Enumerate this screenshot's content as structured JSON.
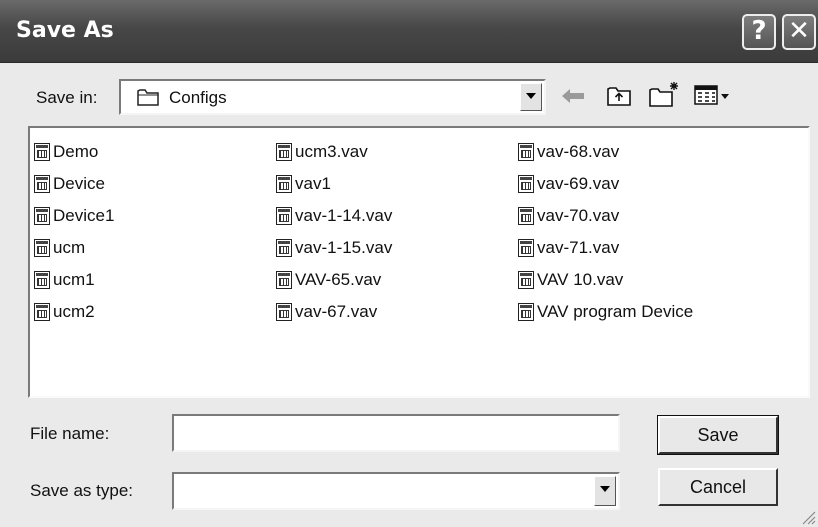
{
  "window": {
    "title": "Save As",
    "help_glyph": "?",
    "close_glyph": "✕"
  },
  "toolbar": {
    "save_in_label": "Save in:",
    "location": "Configs",
    "icons": [
      "back-arrow-icon",
      "up-one-level-icon",
      "new-folder-icon",
      "view-menu-icon"
    ]
  },
  "files": {
    "col1": [
      "Demo",
      "Device",
      "Device1",
      "ucm",
      "ucm1",
      "ucm2"
    ],
    "col2": [
      "ucm3.vav",
      "vav1",
      "vav-1-14.vav",
      "vav-1-15.vav",
      "VAV-65.vav",
      "vav-67.vav"
    ],
    "col3": [
      "vav-68.vav",
      "vav-69.vav",
      "vav-70.vav",
      "vav-71.vav",
      "VAV 10.vav",
      "VAV program Device"
    ]
  },
  "form": {
    "file_name_label": "File name:",
    "file_name_value": "",
    "save_as_type_label": "Save as type:",
    "save_as_type_value": ""
  },
  "buttons": {
    "save": "Save",
    "cancel": "Cancel"
  }
}
